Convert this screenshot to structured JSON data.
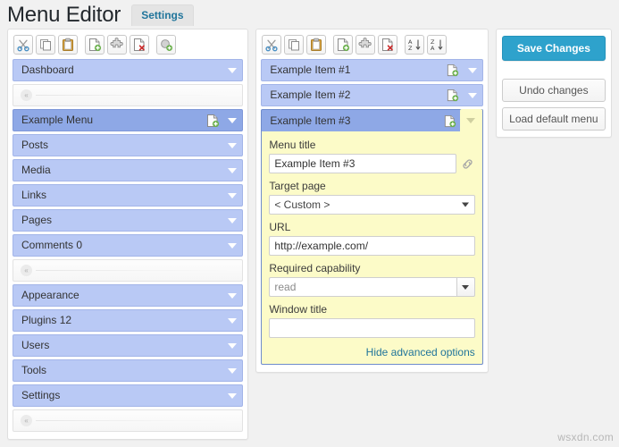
{
  "header": {
    "title": "Menu Editor",
    "tabs": [
      {
        "label": "Settings",
        "active": true
      }
    ]
  },
  "toolbars": {
    "left": [
      {
        "name": "cut-button",
        "icon": "scissors-icon",
        "title": "Cut"
      },
      {
        "name": "copy-button",
        "icon": "copy-icon",
        "title": "Copy"
      },
      {
        "name": "paste-button",
        "icon": "clipboard-icon",
        "title": "Paste"
      },
      {
        "name": "new-menu-button",
        "icon": "page-add-icon",
        "title": "New menu"
      },
      {
        "name": "new-separator-button",
        "icon": "puzzle-icon",
        "title": "New separator"
      },
      {
        "name": "delete-menu-button",
        "icon": "page-delete-icon",
        "title": "Delete menu"
      },
      {
        "name": "show-hidden-button",
        "icon": "bullet-add-icon",
        "title": "Show hidden"
      }
    ],
    "middle": [
      {
        "name": "cut-button",
        "icon": "scissors-icon",
        "title": "Cut"
      },
      {
        "name": "copy-button",
        "icon": "copy-icon",
        "title": "Copy"
      },
      {
        "name": "paste-button",
        "icon": "clipboard-icon",
        "title": "Paste"
      },
      {
        "name": "new-item-button",
        "icon": "page-add-icon",
        "title": "New item"
      },
      {
        "name": "new-separator-button",
        "icon": "puzzle-icon",
        "title": "New separator"
      },
      {
        "name": "delete-item-button",
        "icon": "page-delete-icon",
        "title": "Delete item"
      },
      {
        "name": "sort-asc-button",
        "icon": "sort-az-icon",
        "title": "Sort ascending"
      },
      {
        "name": "sort-desc-button",
        "icon": "sort-za-icon",
        "title": "Sort descending"
      }
    ]
  },
  "menu_list": {
    "rows": [
      {
        "type": "item",
        "label": "Dashboard",
        "selected": false,
        "has_icon": false
      },
      {
        "type": "separator",
        "label": "",
        "selected": false,
        "has_icon": false
      },
      {
        "type": "item",
        "label": "Example Menu",
        "selected": true,
        "has_icon": true
      },
      {
        "type": "item",
        "label": "Posts",
        "selected": false,
        "has_icon": false
      },
      {
        "type": "item",
        "label": "Media",
        "selected": false,
        "has_icon": false
      },
      {
        "type": "item",
        "label": "Links",
        "selected": false,
        "has_icon": false
      },
      {
        "type": "item",
        "label": "Pages",
        "selected": false,
        "has_icon": false
      },
      {
        "type": "item",
        "label": "Comments 0",
        "selected": false,
        "has_icon": false
      },
      {
        "type": "separator",
        "label": "",
        "selected": false,
        "has_icon": false
      },
      {
        "type": "item",
        "label": "Appearance",
        "selected": false,
        "has_icon": false
      },
      {
        "type": "item",
        "label": "Plugins 12",
        "selected": false,
        "has_icon": false
      },
      {
        "type": "item",
        "label": "Users",
        "selected": false,
        "has_icon": false
      },
      {
        "type": "item",
        "label": "Tools",
        "selected": false,
        "has_icon": false
      },
      {
        "type": "item",
        "label": "Settings",
        "selected": false,
        "has_icon": false
      },
      {
        "type": "separator",
        "label": "",
        "selected": false,
        "has_icon": false
      }
    ]
  },
  "submenu_list": {
    "rows": [
      {
        "label": "Example Item #1",
        "selected": false,
        "expanded": false
      },
      {
        "label": "Example Item #2",
        "selected": false,
        "expanded": false
      },
      {
        "label": "Example Item #3",
        "selected": true,
        "expanded": true
      }
    ]
  },
  "editor": {
    "menu_title": {
      "label": "Menu title",
      "value": "Example Item #3",
      "icon": "link-icon"
    },
    "target_page": {
      "label": "Target page",
      "value": "< Custom >"
    },
    "url": {
      "label": "URL",
      "value": "http://example.com/"
    },
    "capability": {
      "label": "Required capability",
      "value": "read"
    },
    "window_title": {
      "label": "Window title",
      "value": "",
      "placeholder": ""
    },
    "advanced_link": "Hide advanced options"
  },
  "actions": {
    "save_label": "Save Changes",
    "undo_label": "Undo changes",
    "load_default_label": "Load default menu"
  },
  "watermark": "wsxdn.com",
  "colors": {
    "accent": "#2ea2cc",
    "item_bg": "#b9c9f5",
    "item_selected_bg": "#8ea8e6",
    "editor_bg": "#fcfbc8",
    "link": "#21759b"
  }
}
